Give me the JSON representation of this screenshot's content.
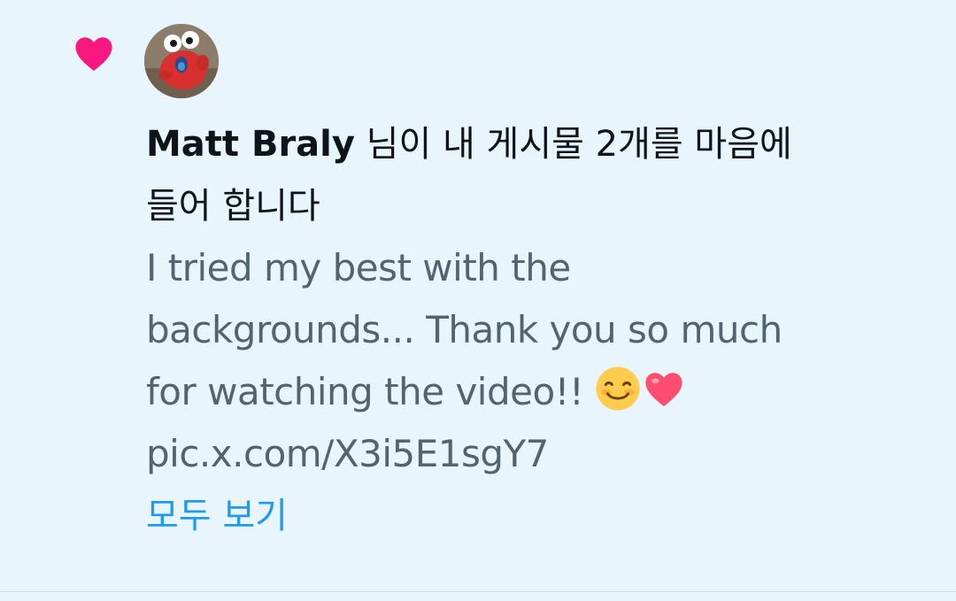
{
  "notification": {
    "actor_name": "Matt Braly",
    "action_text": "님이 내 게시물 2개를 마음에 들어 합니다",
    "action_line1": " 님이 내 게시물 2개를 마음에",
    "action_line2": "들어 합니다",
    "post_text_lines": [
      "I tried my best with the",
      "backgrounds... Thank you so much",
      "for watching the video!!"
    ],
    "post_link": "pic.x.com/X3i5E1sgY7",
    "emojis": [
      "smiling-face-icon",
      "red-heart-icon"
    ],
    "view_all_label": "모두 보기",
    "icon": "heart-icon"
  },
  "colors": {
    "background": "#e8f5fd",
    "like_pink": "#f91880",
    "text_primary": "#0f1419",
    "text_secondary": "#536471",
    "link_blue": "#1d9bf0"
  }
}
